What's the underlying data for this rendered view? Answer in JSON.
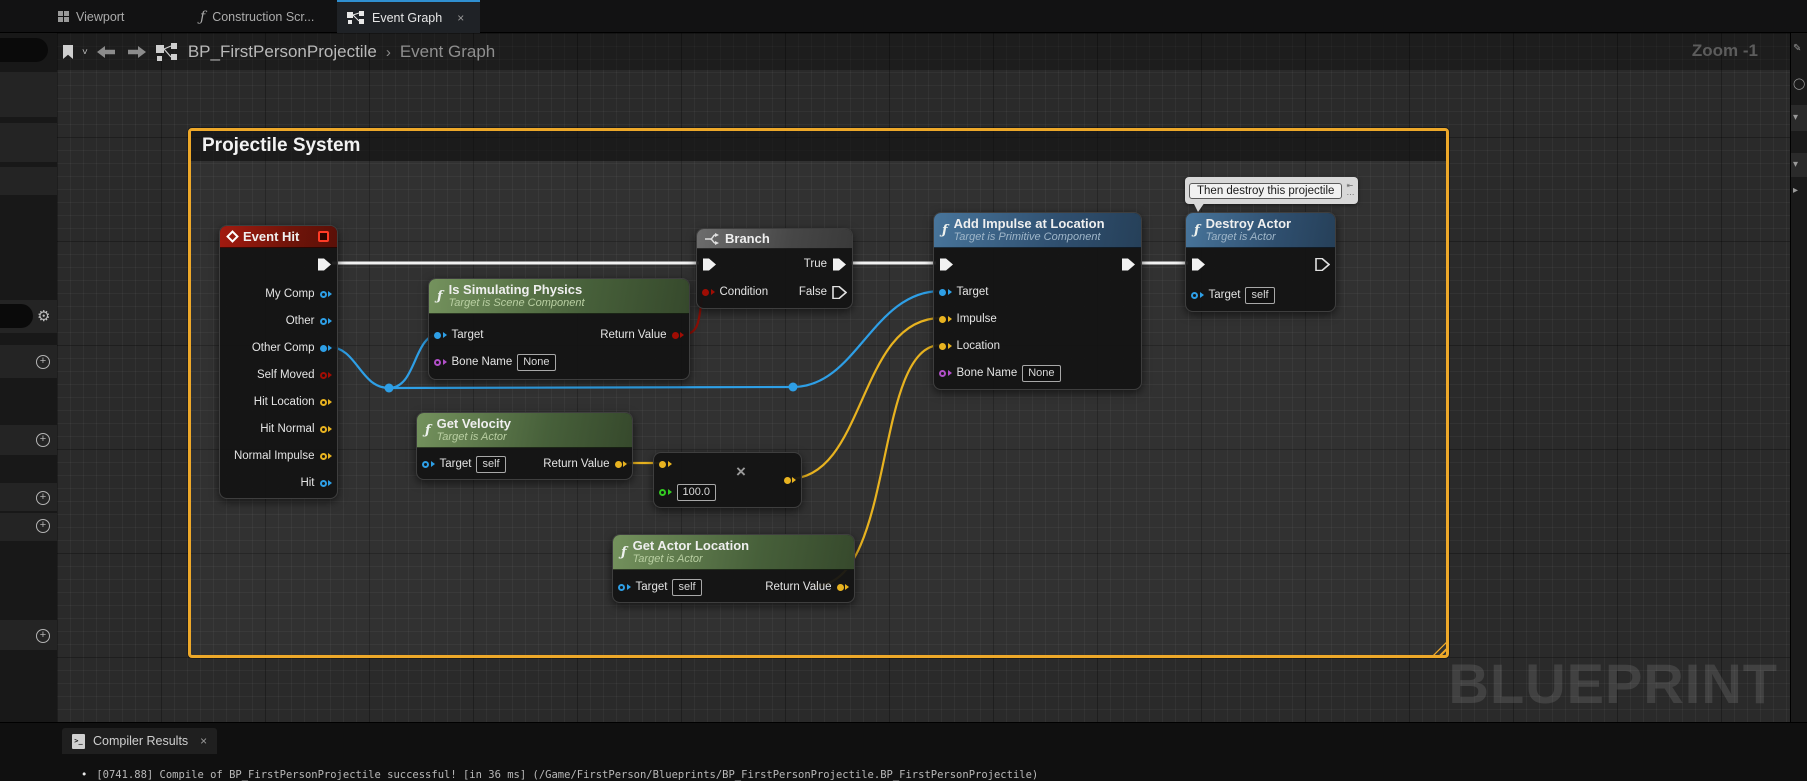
{
  "top_tabs": {
    "viewport": "Viewport",
    "construction": "Construction Scr...",
    "event_graph": "Event Graph",
    "close": "×"
  },
  "breadcrumb": {
    "root": "BP_FirstPersonProjectile",
    "separator": "›",
    "current": "Event Graph"
  },
  "zoom_indicator": "Zoom -1",
  "comment_box": {
    "title": "Projectile System"
  },
  "note_bubble": {
    "text": "Then destroy this projectile"
  },
  "nodes": {
    "event_hit": {
      "title": "Event Hit",
      "pins": [
        "My Comp",
        "Other",
        "Other Comp",
        "Self Moved",
        "Hit Location",
        "Hit Normal",
        "Normal Impulse",
        "Hit"
      ]
    },
    "is_simulating_physics": {
      "title": "Is Simulating Physics",
      "subtitle": "Target is Scene Component",
      "target_label": "Target",
      "bone_name_label": "Bone Name",
      "bone_name_value": "None",
      "return_label": "Return Value"
    },
    "branch": {
      "title": "Branch",
      "condition_label": "Condition",
      "true_label": "True",
      "false_label": "False"
    },
    "get_velocity": {
      "title": "Get Velocity",
      "subtitle": "Target is Actor",
      "target_label": "Target",
      "target_value": "self",
      "return_label": "Return Value"
    },
    "multiply": {
      "operator": "×",
      "value": "100.0"
    },
    "get_actor_location": {
      "title": "Get Actor Location",
      "subtitle": "Target is Actor",
      "target_label": "Target",
      "target_value": "self",
      "return_label": "Return Value"
    },
    "add_impulse_at_location": {
      "title": "Add Impulse at Location",
      "subtitle": "Target is Primitive Component",
      "pins": [
        "Target",
        "Impulse",
        "Location",
        "Bone Name"
      ],
      "bone_name_value": "None"
    },
    "destroy_actor": {
      "title": "Destroy Actor",
      "subtitle": "Target is Actor",
      "target_label": "Target",
      "target_value": "self"
    }
  },
  "connections": [
    {
      "from": "Event Hit.exec",
      "to": "Branch.exec_in",
      "type": "exec"
    },
    {
      "from": "Event Hit.Other Comp",
      "to": "Is Simulating Physics.Target",
      "type": "object"
    },
    {
      "from": "Event Hit.Other Comp",
      "to": "Add Impulse at Location.Target",
      "type": "object"
    },
    {
      "from": "Is Simulating Physics.Return Value",
      "to": "Branch.Condition",
      "type": "bool"
    },
    {
      "from": "Branch.True",
      "to": "Add Impulse at Location.exec_in",
      "type": "exec"
    },
    {
      "from": "Get Velocity.Return Value",
      "to": "Multiply.A",
      "type": "vector"
    },
    {
      "from": "Multiply.Result",
      "to": "Add Impulse at Location.Impulse",
      "type": "vector"
    },
    {
      "from": "Get Actor Location.Return Value",
      "to": "Add Impulse at Location.Location",
      "type": "vector"
    },
    {
      "from": "Add Impulse at Location.exec_out",
      "to": "Destroy Actor.exec_in",
      "type": "exec"
    }
  ],
  "sidebar": {
    "icons": [
      "gear-icon",
      "plus-circle-icon",
      "plus-circle-icon",
      "plus-circle-icon",
      "plus-circle-icon",
      "plus-circle-icon"
    ]
  },
  "compiler": {
    "tab_label": "Compiler Results",
    "close": "×",
    "bullet": "•",
    "log": "[0741.88] Compile of BP_FirstPersonProjectile successful! [in 36 ms] (/Game/FirstPerson/Blueprints/BP_FirstPersonProjectile.BP_FirstPersonProjectile)"
  },
  "watermark": "BLUEPRINT",
  "colors": {
    "exec_wire": "#f2f2f2",
    "object_pin": "#2e9fe6",
    "bool_pin": "#a00d04",
    "vector_pin": "#e8b320",
    "name_pin": "#b14fc8",
    "float_pin": "#33cc22",
    "comment_border": "#eda829",
    "active_tab_accent": "#2f8fd0",
    "event_header": "#a31b10",
    "pure_function_header": "#74925d",
    "function_header": "#48759b"
  }
}
